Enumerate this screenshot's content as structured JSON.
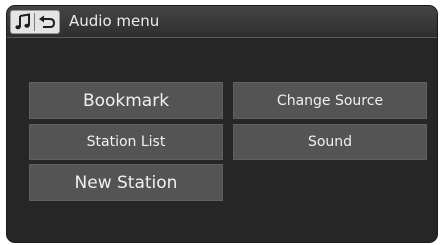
{
  "header": {
    "title": "Audio menu",
    "icons": [
      "music-note-icon",
      "back-arrow-icon"
    ]
  },
  "menu": {
    "bookmark": "Bookmark",
    "change_source": "Change Source",
    "station_list": "Station List",
    "sound": "Sound",
    "new_station": "New Station"
  },
  "colors": {
    "screen_bg": "#262626",
    "button_bg": "#545454",
    "text": "#f0f0f0"
  }
}
